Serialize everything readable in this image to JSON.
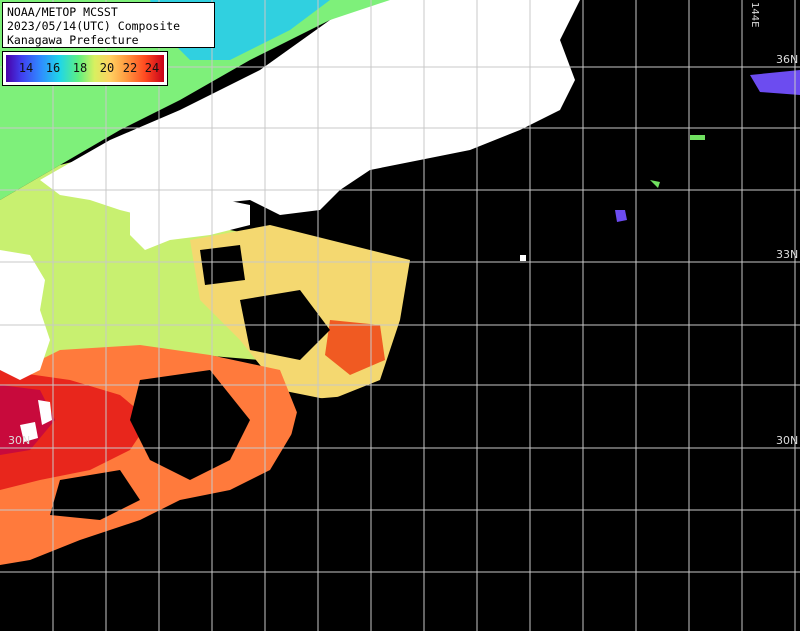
{
  "header": {
    "line1": "NOAA/METOP MCSST",
    "line2": "2023/05/14(UTC) Composite",
    "line3": "Kanagawa Prefecture"
  },
  "legend": {
    "ticks": [
      "14",
      "16",
      "18",
      "20",
      "22",
      "24"
    ]
  },
  "grid_labels": {
    "lat_33_right": "33N",
    "lat_36_right": "36N",
    "lat_30_left": "30N",
    "lat_30_right": "30N",
    "lon_top": "144E"
  },
  "colors": {
    "ocean_nodata": "#000000",
    "land": "#ffffff",
    "grid": "#c8c8c8",
    "cold": "#30c8e0",
    "cool": "#80f070",
    "mild": "#f0e070",
    "warm": "#ff8040",
    "hot": "#e01a1a"
  }
}
